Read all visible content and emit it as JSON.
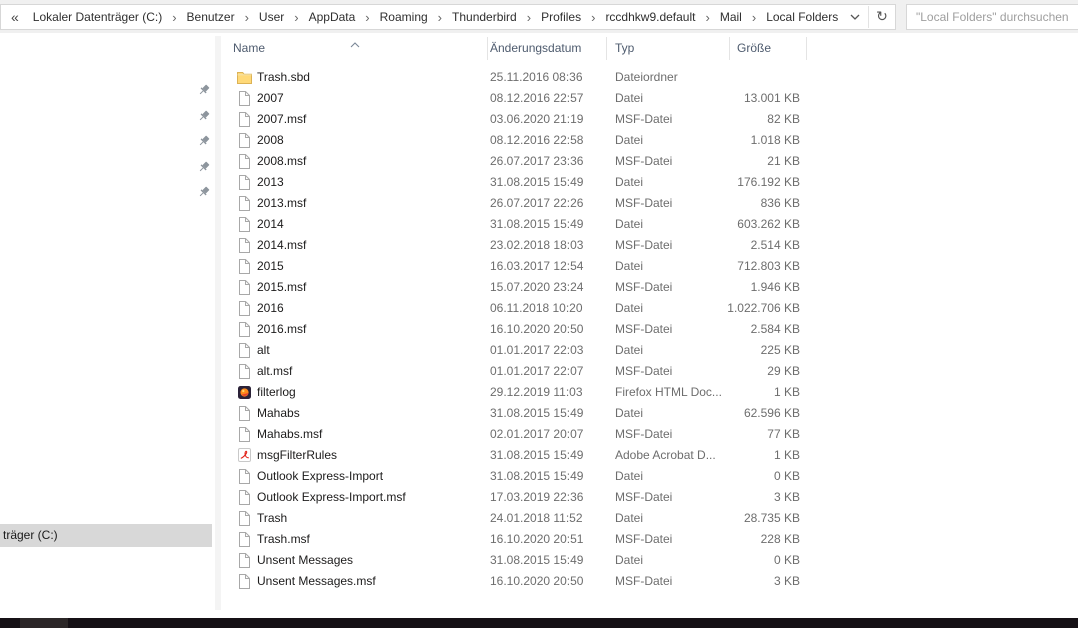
{
  "address_bar": {
    "overflow_chevron": "«",
    "separator": "›",
    "breadcrumb": [
      "Lokaler Datenträger (C:)",
      "Benutzer",
      "User",
      "AppData",
      "Roaming",
      "Thunderbird",
      "Profiles",
      "rccdhkw9.default",
      "Mail",
      "Local Folders"
    ],
    "dropdown_icon": "chevron-down-icon",
    "refresh_icon": "refresh-icon",
    "refresh_glyph": "↻"
  },
  "search": {
    "placeholder": "\"Local Folders\" durchsuchen"
  },
  "nav_pane": {
    "pinned_count": 5,
    "pin_icon": "pushpin-icon",
    "highlighted_item": "träger (C:)"
  },
  "file_list": {
    "columns": [
      {
        "label": "Name",
        "sort": "ascending"
      },
      {
        "label": "Änderungsdatum",
        "sort": "none"
      },
      {
        "label": "Typ",
        "sort": "none"
      },
      {
        "label": "Größe",
        "sort": "none"
      }
    ],
    "rows": [
      {
        "name": "Trash.sbd",
        "date": "25.11.2016 08:36",
        "type": "Dateiordner",
        "size": "",
        "icon": "folder"
      },
      {
        "name": "2007",
        "date": "08.12.2016 22:57",
        "type": "Datei",
        "size": "13.001 KB",
        "icon": "file"
      },
      {
        "name": "2007.msf",
        "date": "03.06.2020 21:19",
        "type": "MSF-Datei",
        "size": "82 KB",
        "icon": "file"
      },
      {
        "name": "2008",
        "date": "08.12.2016 22:58",
        "type": "Datei",
        "size": "1.018 KB",
        "icon": "file"
      },
      {
        "name": "2008.msf",
        "date": "26.07.2017 23:36",
        "type": "MSF-Datei",
        "size": "21 KB",
        "icon": "file"
      },
      {
        "name": "2013",
        "date": "31.08.2015 15:49",
        "type": "Datei",
        "size": "176.192 KB",
        "icon": "file"
      },
      {
        "name": "2013.msf",
        "date": "26.07.2017 22:26",
        "type": "MSF-Datei",
        "size": "836 KB",
        "icon": "file"
      },
      {
        "name": "2014",
        "date": "31.08.2015 15:49",
        "type": "Datei",
        "size": "603.262 KB",
        "icon": "file"
      },
      {
        "name": "2014.msf",
        "date": "23.02.2018 18:03",
        "type": "MSF-Datei",
        "size": "2.514 KB",
        "icon": "file"
      },
      {
        "name": "2015",
        "date": "16.03.2017 12:54",
        "type": "Datei",
        "size": "712.803 KB",
        "icon": "file"
      },
      {
        "name": "2015.msf",
        "date": "15.07.2020 23:24",
        "type": "MSF-Datei",
        "size": "1.946 KB",
        "icon": "file"
      },
      {
        "name": "2016",
        "date": "06.11.2018 10:20",
        "type": "Datei",
        "size": "1.022.706 KB",
        "icon": "file"
      },
      {
        "name": "2016.msf",
        "date": "16.10.2020 20:50",
        "type": "MSF-Datei",
        "size": "2.584 KB",
        "icon": "file"
      },
      {
        "name": "alt",
        "date": "01.01.2017 22:03",
        "type": "Datei",
        "size": "225 KB",
        "icon": "file"
      },
      {
        "name": "alt.msf",
        "date": "01.01.2017 22:07",
        "type": "MSF-Datei",
        "size": "29 KB",
        "icon": "file"
      },
      {
        "name": "filterlog",
        "date": "29.12.2019 11:03",
        "type": "Firefox HTML Doc...",
        "size": "1 KB",
        "icon": "firefox"
      },
      {
        "name": "Mahabs",
        "date": "31.08.2015 15:49",
        "type": "Datei",
        "size": "62.596 KB",
        "icon": "file"
      },
      {
        "name": "Mahabs.msf",
        "date": "02.01.2017 20:07",
        "type": "MSF-Datei",
        "size": "77 KB",
        "icon": "file"
      },
      {
        "name": "msgFilterRules",
        "date": "31.08.2015 15:49",
        "type": "Adobe Acrobat D...",
        "size": "1 KB",
        "icon": "acrobat"
      },
      {
        "name": "Outlook Express-Import",
        "date": "31.08.2015 15:49",
        "type": "Datei",
        "size": "0 KB",
        "icon": "file"
      },
      {
        "name": "Outlook Express-Import.msf",
        "date": "17.03.2019 22:36",
        "type": "MSF-Datei",
        "size": "3 KB",
        "icon": "file"
      },
      {
        "name": "Trash",
        "date": "24.01.2018 11:52",
        "type": "Datei",
        "size": "28.735 KB",
        "icon": "file"
      },
      {
        "name": "Trash.msf",
        "date": "16.10.2020 20:51",
        "type": "MSF-Datei",
        "size": "228 KB",
        "icon": "file"
      },
      {
        "name": "Unsent Messages",
        "date": "31.08.2015 15:49",
        "type": "Datei",
        "size": "0 KB",
        "icon": "file"
      },
      {
        "name": "Unsent Messages.msf",
        "date": "16.10.2020 20:50",
        "type": "MSF-Datei",
        "size": "3 KB",
        "icon": "file"
      }
    ]
  },
  "colors": {
    "folder_yellow": "#ffd978",
    "firefox_orange": "#ff8b1b",
    "acrobat_red": "#e2231a",
    "header_text": "#4e5b6e",
    "meta_text": "#6d6d6d",
    "nav_highlight": "#d8d8d8",
    "taskbar_black": "#151015"
  }
}
